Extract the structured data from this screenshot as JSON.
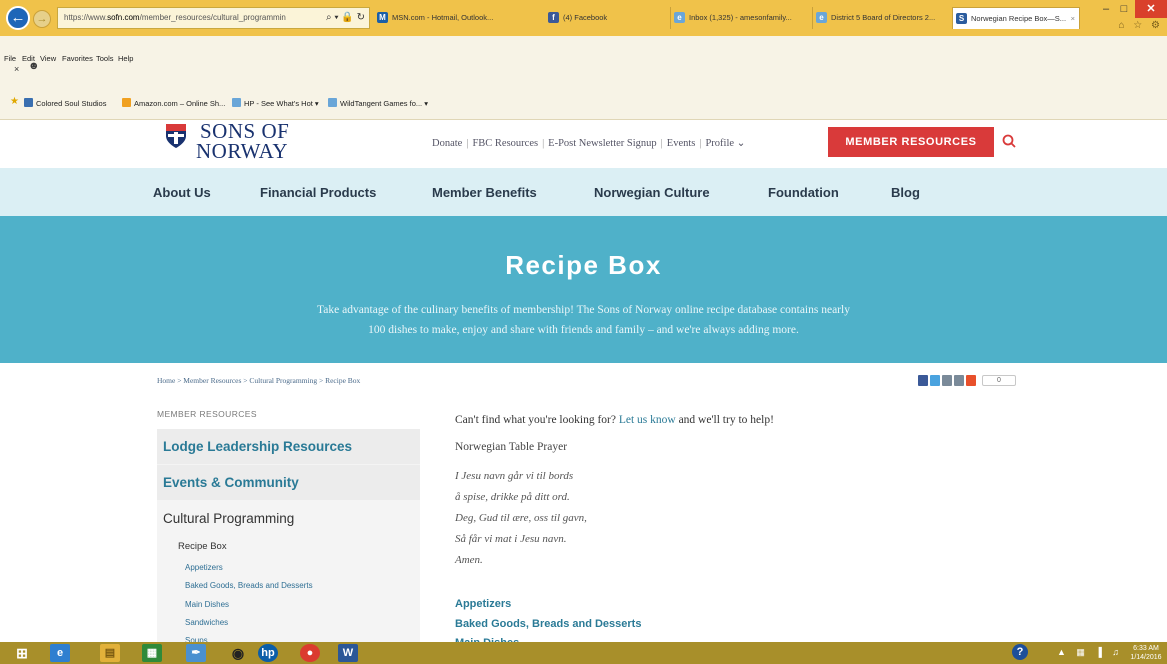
{
  "browser": {
    "address": {
      "prefix": "https://www.",
      "domain": "sofn.com",
      "path": "/member_resources/cultural_programmin",
      "controls": "⌕ ▾ 🔒 ↻"
    },
    "tabs": [
      {
        "label": "MSN.com - Hotmail, Outlook...",
        "icon": "msn-icon"
      },
      {
        "label": "(4) Facebook",
        "icon": "facebook-icon"
      },
      {
        "label": "Inbox (1,325) - amesonfamily...",
        "icon": "ie-icon"
      },
      {
        "label": "District 5 Board of Directors 2...",
        "icon": "ie-icon"
      },
      {
        "label": "Norwegian Recipe Box—S...",
        "icon": "sons-of-norway-icon",
        "close": "×"
      }
    ],
    "window_controls": {
      "minimize": "–",
      "maximize": "□",
      "close": "✕"
    },
    "toolbar_icons": "⌂ ☆ ⚙",
    "menu": [
      "File",
      "Edit",
      "View",
      "Favorites",
      "Tools",
      "Help"
    ],
    "menu_close": "×",
    "favorites": [
      {
        "label": "Colored Soul Studios",
        "color": "#3a6fb0"
      },
      {
        "label": "Amazon.com – Online Sh...",
        "color": "#f0a020"
      },
      {
        "label": "HP - See What's Hot ▾",
        "color": "#6aa6d8"
      },
      {
        "label": "WildTangent Games fo... ▾",
        "color": "#6aa6d8"
      }
    ]
  },
  "site": {
    "logo_line1": "SONS OF",
    "logo_line2": "NORWAY",
    "util_links": [
      "Donate",
      "FBC Resources",
      "E-Post Newsletter Signup",
      "Events",
      "Profile ⌄"
    ],
    "util_sep": "|",
    "member_button": "MEMBER RESOURCES",
    "nav": [
      "About Us",
      "Financial Products",
      "Member Benefits",
      "Norwegian Culture",
      "Foundation",
      "Blog"
    ],
    "colors": {
      "accent_red": "#d93a3a",
      "hero_teal": "#4fb1c9",
      "nav_bg": "#dbeff4",
      "link_teal": "#2a7a96"
    }
  },
  "hero": {
    "title": "Recipe Box",
    "line1": "Take advantage of the culinary benefits of membership! The Sons of Norway online recipe database contains nearly",
    "line2": "100 dishes to make, enjoy and share with friends and family – and we're always adding more."
  },
  "breadcrumb": "Home > Member Resources > Cultural Programming > Recipe Box",
  "share": {
    "count": "0"
  },
  "sidebar": {
    "heading": "MEMBER RESOURCES",
    "items": [
      "Lodge Leadership Resources",
      "Events & Community",
      "Cultural Programming"
    ],
    "current": "Recipe Box",
    "subitems": [
      "Appetizers",
      "Baked Goods, Breads and Desserts",
      "Main Dishes",
      "Sandwiches",
      "Soups"
    ]
  },
  "main": {
    "intro_before": "Can't find what you're looking for?",
    "intro_link": "Let us know",
    "intro_after": "and we'll try to help!",
    "prayer_title": "Norwegian Table Prayer",
    "prayer_lines": [
      "I Jesu navn går vi til bords",
      "å spise, drikke på ditt ord.",
      "Deg, Gud til ære, oss til gavn,",
      "Så får vi mat i Jesu navn.",
      "Amen."
    ],
    "categories": [
      "Appetizers",
      "Baked Goods, Breads and Desserts",
      "Main Dishes"
    ]
  },
  "taskbar": {
    "clock_time": "6:33 AM",
    "clock_date": "1/14/2016",
    "help": "?"
  }
}
